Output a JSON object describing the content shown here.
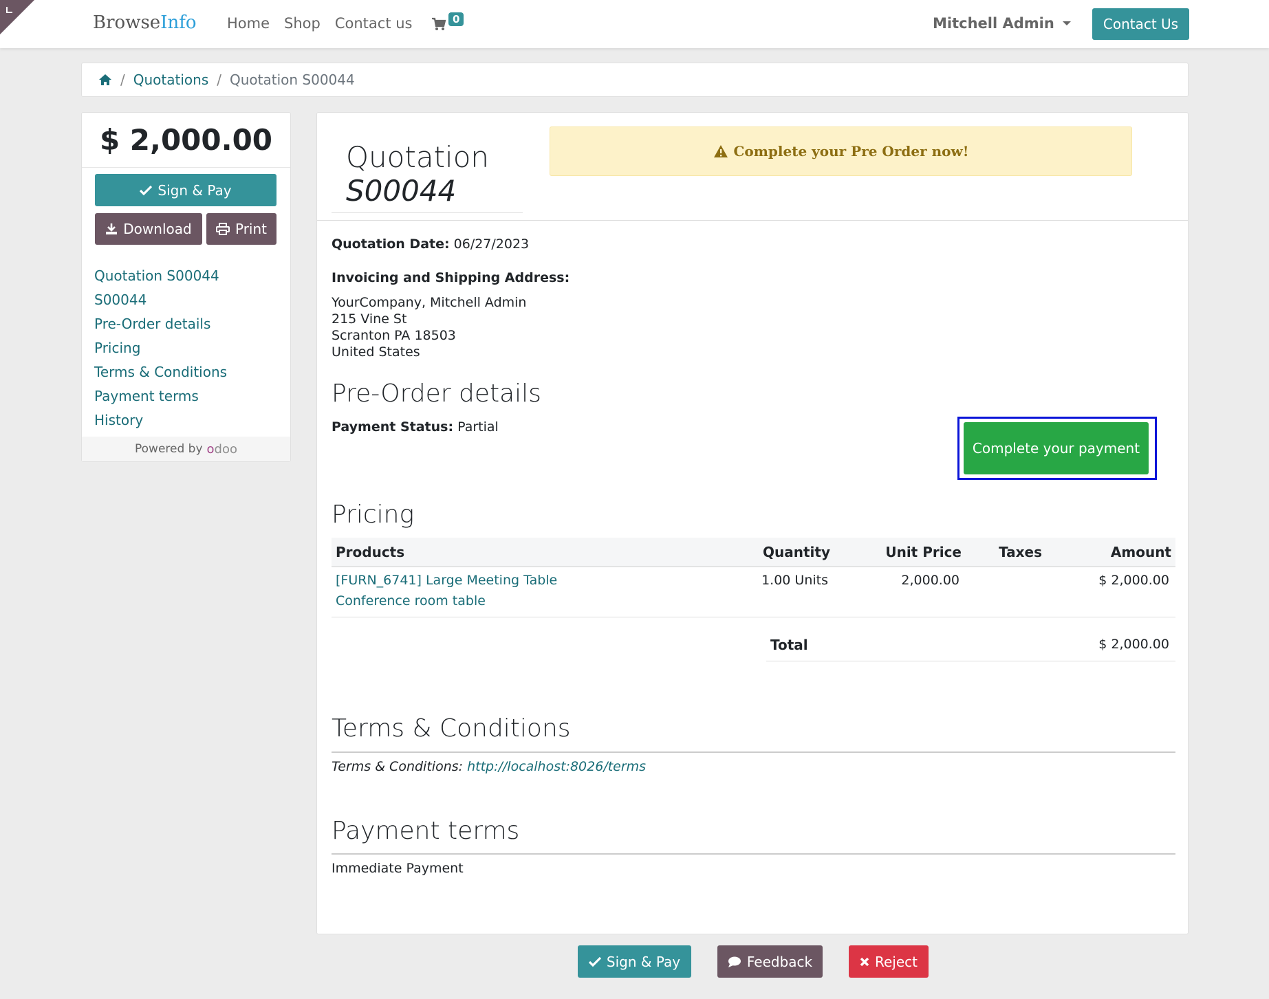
{
  "header": {
    "logo_part1": "Browse",
    "logo_part2": "Info",
    "nav": [
      "Home",
      "Shop",
      "Contact us"
    ],
    "cart_count": "0",
    "user": "Mitchell Admin",
    "contact_button": "Contact Us"
  },
  "breadcrumb": {
    "quotations": "Quotations",
    "current": "Quotation S00044"
  },
  "sidebar": {
    "total": "$ 2,000.00",
    "sign_pay": "Sign & Pay",
    "download": "Download",
    "print": "Print",
    "toc": [
      "Quotation S00044",
      "S00044",
      "Pre-Order details",
      "Pricing",
      "Terms & Conditions",
      "Payment terms",
      "History"
    ],
    "powered_by": "Powered by",
    "odoo_o": "o",
    "odoo_rest": "doo"
  },
  "quotation": {
    "title": "Quotation",
    "number": "S00044",
    "alert": "Complete your Pre Order now!",
    "date_label": "Quotation Date:",
    "date": "06/27/2023",
    "address_label": "Invoicing and Shipping Address:",
    "address": [
      "YourCompany, Mitchell Admin",
      "215 Vine St",
      "Scranton PA 18503",
      "United States"
    ]
  },
  "preorder": {
    "heading": "Pre-Order details",
    "status_label": "Payment Status:",
    "status": "Partial",
    "cta": "Complete your payment"
  },
  "pricing": {
    "heading": "Pricing",
    "columns": [
      "Products",
      "Quantity",
      "Unit Price",
      "Taxes",
      "Amount"
    ],
    "rows": [
      {
        "product_line1": "[FURN_6741] Large Meeting Table",
        "product_line2": "Conference room table",
        "quantity": "1.00 Units",
        "unit_price": "2,000.00",
        "taxes": "",
        "amount": "$ 2,000.00"
      }
    ],
    "total_label": "Total",
    "total": "$ 2,000.00"
  },
  "terms": {
    "heading": "Terms & Conditions",
    "label": "Terms & Conditions:",
    "link": "http://localhost:8026/terms"
  },
  "payment_terms": {
    "heading": "Payment terms",
    "value": "Immediate Payment"
  },
  "actions": {
    "sign_pay": "Sign & Pay",
    "feedback": "Feedback",
    "reject": "Reject"
  },
  "colors": {
    "accent": "#35939a",
    "secondary": "#6b5662",
    "success": "#28a745",
    "danger": "#dc3545",
    "alert_bg": "#fdf2c9",
    "highlight_frame": "#0a14d8"
  }
}
